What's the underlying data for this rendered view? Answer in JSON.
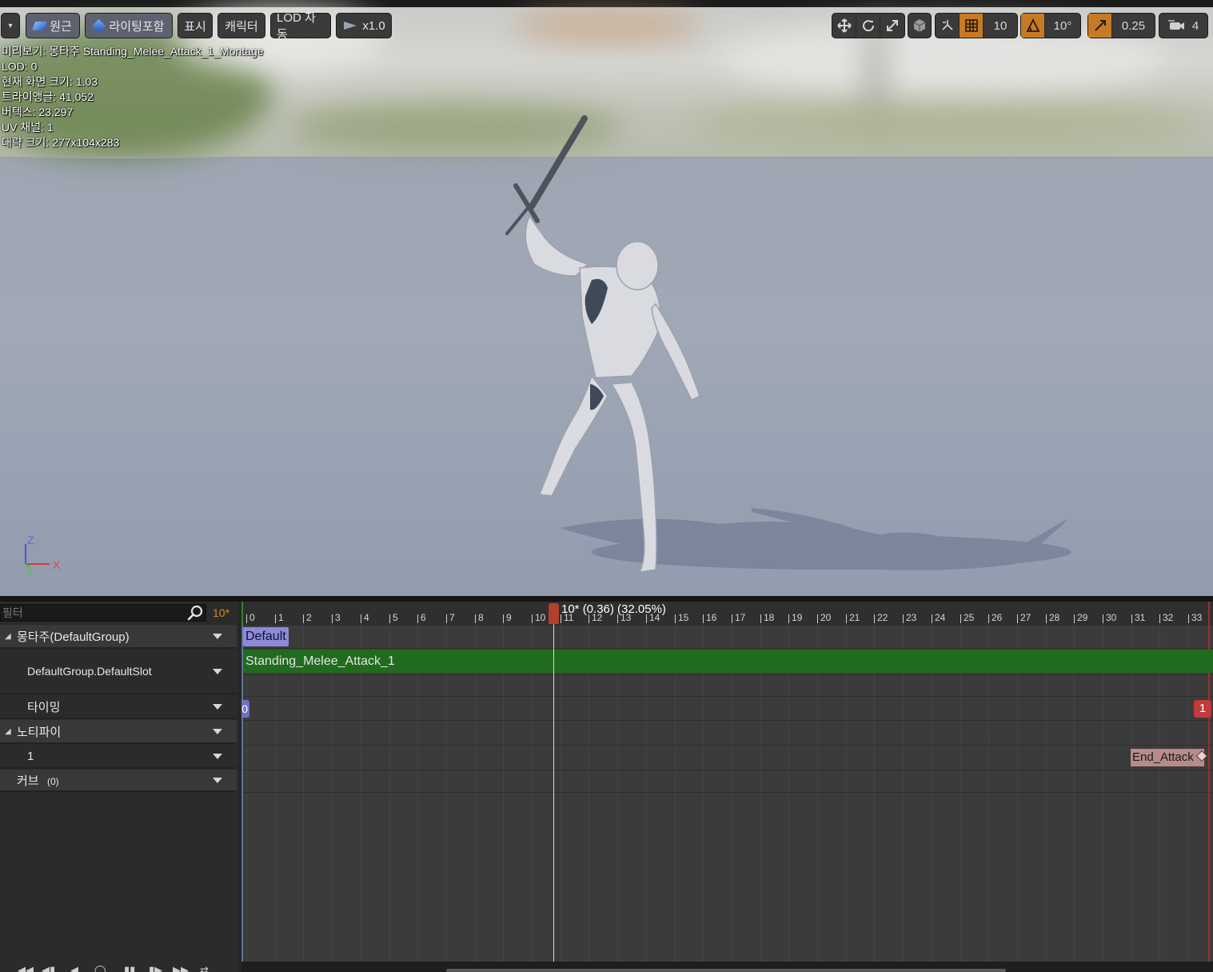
{
  "viewport": {
    "options_caret": "▾",
    "buttons": {
      "perspective": "원근",
      "lighting": "라이팅포함",
      "show": "표시",
      "character": "캐릭터",
      "lod": "LOD 자동",
      "playback_speed": "x1.0"
    },
    "right_toolbar": {
      "grid_snap_value": "10",
      "rotation_snap_value": "10°",
      "scale_snap_value": "0.25",
      "camera_speed_value": "4"
    },
    "stats": {
      "preview": "미리보기: 몽타주 Standing_Melee_Attack_1_Montage",
      "lod": "LOD: 0",
      "screen_size": "현재 화면 크기: 1.03",
      "triangles": "트라이앵글: 41,052",
      "vertices": "버텍스: 23,297",
      "uv_channels": "UV 채널: 1",
      "approx_size": "대략 크기: 277x104x283"
    },
    "axis": {
      "z": "Z",
      "y": "Y",
      "x": "X"
    }
  },
  "tracks": {
    "filter_placeholder": "필터",
    "fps_label": "10*",
    "rows": {
      "montage_group": "몽타주(DefaultGroup)",
      "slot": "DefaultGroup.DefaultSlot",
      "timing": "타이밍",
      "notifies": "노티파이",
      "notify_track_1": "1",
      "curves": "커브",
      "curves_count": "(0)"
    }
  },
  "timeline": {
    "playhead_label": "10* (0.36) (32.05%)",
    "current_frame": 10,
    "ticks": [
      "0",
      "1",
      "2",
      "3",
      "4",
      "5",
      "6",
      "7",
      "8",
      "9",
      "10",
      "11",
      "12",
      "13",
      "14",
      "15",
      "16",
      "17",
      "18",
      "19",
      "20",
      "21",
      "22",
      "23",
      "24",
      "25",
      "26",
      "27",
      "28",
      "29",
      "30",
      "31",
      "32",
      "33"
    ],
    "section_label": "Default",
    "anim_segment": "Standing_Melee_Attack_1",
    "timing_start": "0",
    "timing_end": "1",
    "notify_name": "End_Attack"
  },
  "colors": {
    "accent_orange": "#c77a24",
    "segment_green": "#216b1f",
    "playhead_red": "#b2402c",
    "section_purple": "#8d8bd6",
    "notify_pink": "#b78b8b"
  },
  "icons": [
    "options-caret-icon",
    "perspective-icon",
    "lighting-cube-icon",
    "playback-icon",
    "translate-icon",
    "rotate-icon",
    "scale-icon",
    "world-local-icon",
    "surface-snap-icon",
    "grid-snap-icon",
    "rotation-snap-icon",
    "scale-snap-icon",
    "camera-speed-icon",
    "search-icon"
  ]
}
